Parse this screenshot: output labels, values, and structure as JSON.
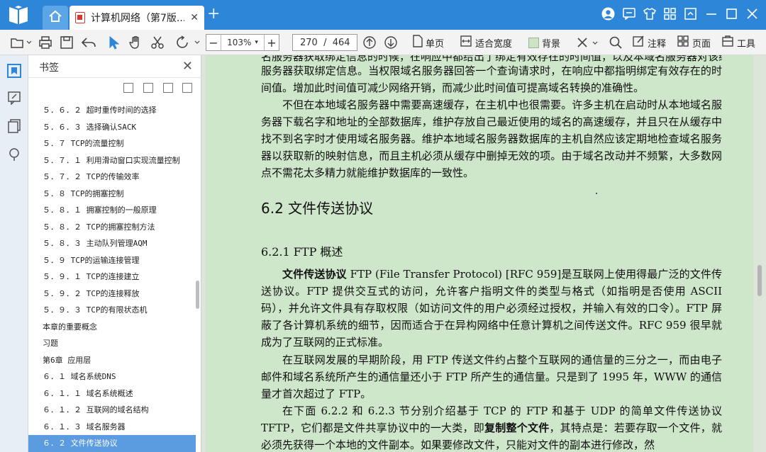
{
  "tab": {
    "title": "计算机网络（第7版..."
  },
  "toolbar": {
    "zoom": "103%",
    "zoom_minus": "−",
    "zoom_plus": "+",
    "page": "270  /  464",
    "single_page": "单页",
    "fit_width": "适合宽度",
    "background": "背景",
    "annotate": "注释",
    "page_view": "页面",
    "tools": "工具"
  },
  "bookmarks": {
    "title": "书签",
    "items": [
      "５．６．２ 超时重传时间的选择",
      "５．６．３ 选择确认SACK",
      "５．７ TCP的流量控制",
      "５．７．１ 利用滑动窗口实现流量控制",
      "５．７．２ TCP的传输效率",
      "５．８ TCP的拥塞控制",
      "５．８．１ 拥塞控制的一般原理",
      "５．８．２ TCP的拥塞控制方法",
      "５．８．３ 主动队列管理AQM",
      "５．９ TCP的运输连接管理",
      "５．９．１ TCP的连接建立",
      "５．９．２ TCP的连接释放",
      "５．９．３ TCP的有限状态机",
      "本章的重要概念",
      "习题",
      "第6章 应用层",
      "６．１ 域名系统DNS",
      "６．１．１ 域名系统概述",
      "６．１．２ 互联网的域名结构",
      "６．１．３ 域名服务器",
      "６．２ 文件传送协议"
    ],
    "selected_index": 20
  },
  "doc": {
    "cut_top": "名服务器获取绑定信息的时候，在响应中都给出了绑定有效存在的时间值，以及本域名服务器对该绑定信息",
    "p1": "服务器获取绑定信息。当权限域名服务器回答一个查询请求时，在响应中都指明绑定有效存在的时间值。增加此时间值可减少网络开销，而减少此时间值可提高域名转换的准确性。",
    "p2": "不但在本地域名服务器中需要高速缓存，在主机中也很需要。许多主机在启动时从本地域名服务器下载名字和地址的全部数据库，维护存放自己最近使用的域名的高速缓存，并且只在从缓存中找不到名字时才使用域名服务器。维护本地域名服务器数据库的主机自然应该定期地检查域名服务器以获取新的映射信息，而且主机必须从缓存中删掉无效的项。由于域名改动并不频繁，大多数网点不需花太多精力就能维护数据库的一致性。",
    "h_section": "6.2   文件传送协议",
    "h_sub": "6.2.1    FTP 概述",
    "p3_bold": "文件传送协议",
    "p3": " FTP (File Transfer Protocol) [RFC 959]是互联网上使用得最广泛的文件传送协议。FTP 提供交互式的访问，允许客户指明文件的类型与格式（如指明是否使用 ASCII 码），并允许文件具有存取权限（如访问文件的用户必须经过授权，并输入有效的口令）。FTP 屏蔽了各计算机系统的细节，因而适合于在异构网络中任意计算机之间传送文件。RFC 959 很早就成为了互联网的正式标准。",
    "p4": "在互联网发展的早期阶段，用 FTP 传送文件约占整个互联网的通信量的三分之一，而由电子邮件和域名系统所产生的通信量还小于 FTP 所产生的通信量。只是到了 1995 年，WWW 的通信量才首次超过了 FTP。",
    "p5_a": "在下面 6.2.2 和 6.2.3 节分别介绍基于 TCP 的 FTP 和基于 UDP 的简单文件传送协议 TFTP，它们都是文件共享协议中的一大类，即",
    "p5_bold": "复制整个文件",
    "p5_b": "，其特点是：若要存取一个文件，就必须先获得一个本地的文件副本。如果要修改文件，只能对文件的副本进行修改，然"
  },
  "colors": {
    "titlebar": "#2E86D8",
    "page_bg": "#CEE6CA",
    "selected": "#5B9BE0"
  }
}
